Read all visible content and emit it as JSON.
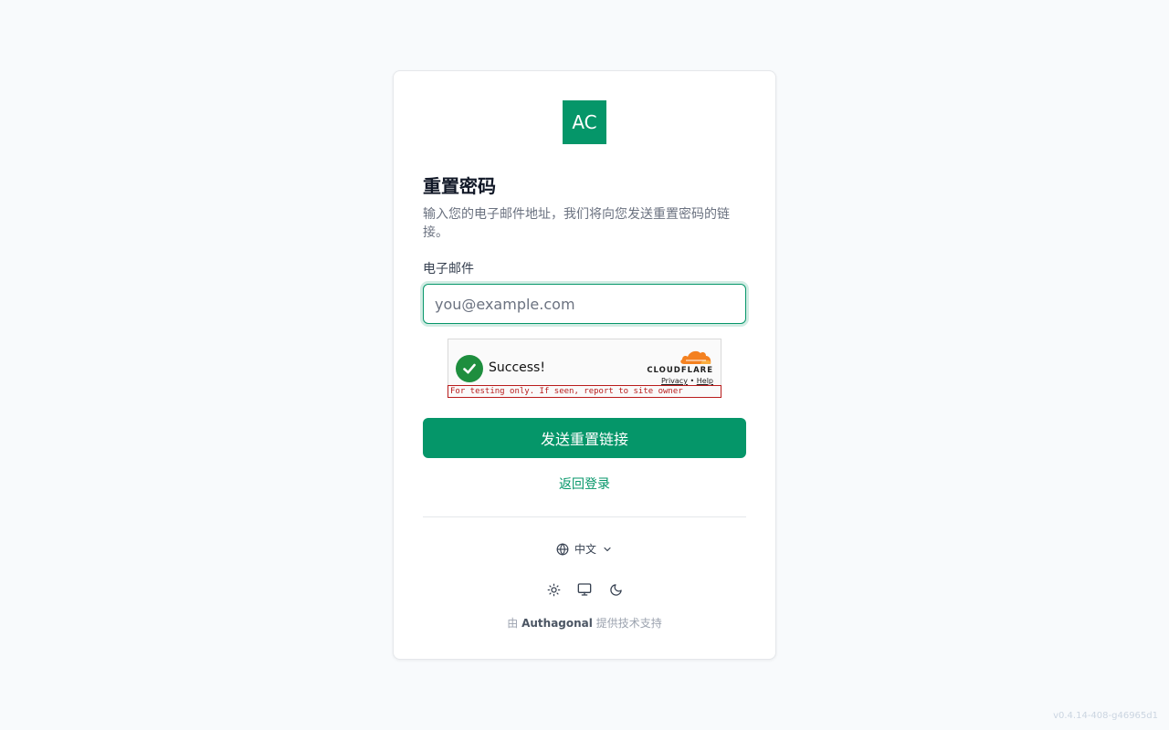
{
  "brand": {
    "logo_text": "AC",
    "color": "#059669"
  },
  "form": {
    "title": "重置密码",
    "subtitle": "输入您的电子邮件地址，我们将向您发送重置密码的链接。",
    "email_label": "电子邮件",
    "email_placeholder": "you@example.com",
    "email_value": "",
    "submit_label": "发送重置链接",
    "back_label": "返回登录"
  },
  "turnstile": {
    "status": "Success!",
    "brand": "CLOUDFLARE",
    "privacy": "Privacy",
    "separator": "•",
    "help": "Help",
    "warning": "For testing only. If seen, report to site owner"
  },
  "footer": {
    "language": "中文",
    "theme_icons": [
      "sun-icon",
      "monitor-icon",
      "moon-icon"
    ],
    "powered_prefix": "由",
    "powered_brand": "Authagonal",
    "powered_suffix": "提供技术支持"
  },
  "version": "v0.4.14-408-g46965d1"
}
